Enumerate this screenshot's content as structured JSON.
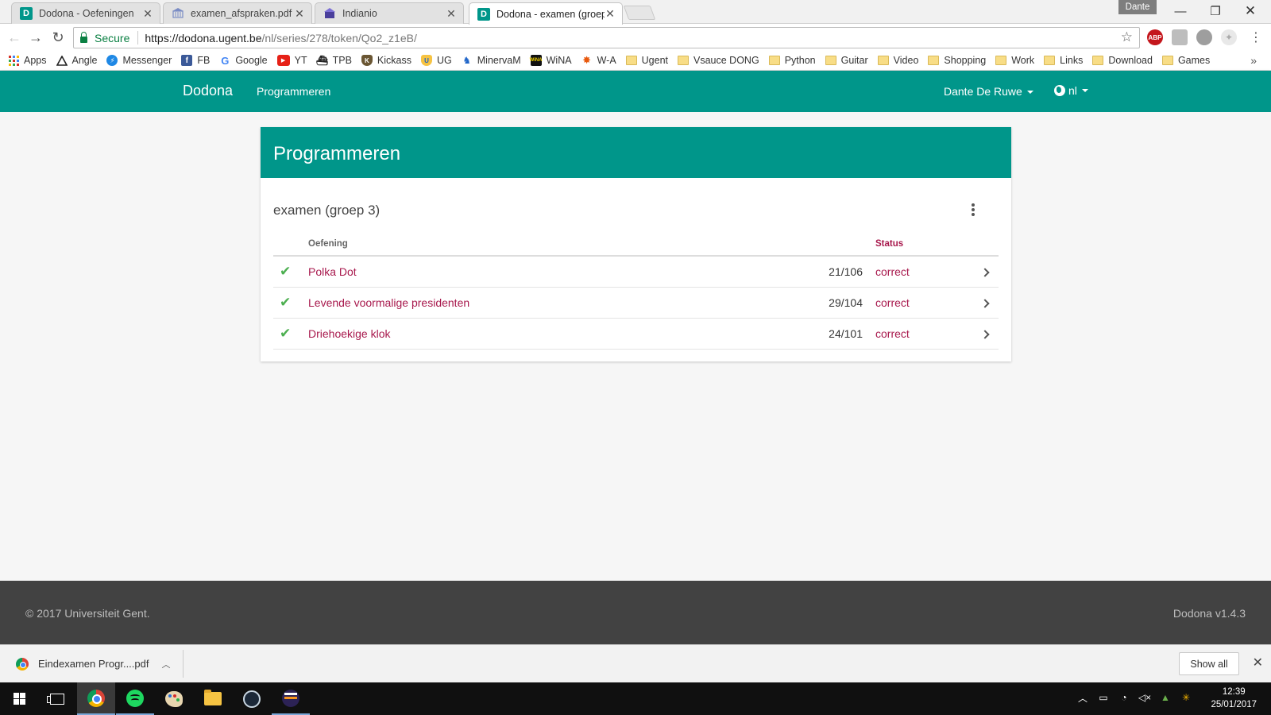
{
  "browser": {
    "tabs": [
      {
        "title": "Dodona - Oefeningen",
        "favicon": "D",
        "icon": "dodona-favicon-icon",
        "active": false
      },
      {
        "title": "examen_afspraken.pdf",
        "icon": "ugent-favicon-icon",
        "active": false
      },
      {
        "title": "Indianio",
        "icon": "indianio-favicon-icon",
        "active": false
      },
      {
        "title": "Dodona - examen (groep",
        "favicon": "D",
        "icon": "dodona-favicon-icon",
        "active": true
      }
    ],
    "profile_name": "Dante",
    "security_label": "Secure",
    "url_host": "https://dodona.ugent.be",
    "url_path": "/nl/series/278/token/Qo2_z1eB/",
    "extensions": [
      {
        "name": "abp-icon",
        "label": "ABP",
        "color": "#c4161c"
      },
      {
        "name": "drive-icon",
        "label": "",
        "color": "#bdbdbd"
      },
      {
        "name": "extension-circle-icon",
        "label": "",
        "color": "#9e9e9e"
      },
      {
        "name": "extension-leaf-icon",
        "label": "",
        "color": "#cfcfcf"
      }
    ]
  },
  "bookmarks": [
    {
      "label": "Apps",
      "icon": "apps-grid-icon"
    },
    {
      "label": "Angle",
      "icon": "triangle-icon"
    },
    {
      "label": "Messenger",
      "icon": "messenger-icon"
    },
    {
      "label": "FB",
      "icon": "facebook-icon"
    },
    {
      "label": "Google",
      "icon": "google-icon"
    },
    {
      "label": "YT",
      "icon": "youtube-icon"
    },
    {
      "label": "TPB",
      "icon": "ship-icon"
    },
    {
      "label": "Kickass",
      "icon": "kickass-icon"
    },
    {
      "label": "UG",
      "icon": "ug-icon"
    },
    {
      "label": "MinervaM",
      "icon": "minerva-icon"
    },
    {
      "label": "WiNA",
      "icon": "wina-icon"
    },
    {
      "label": "W-A",
      "icon": "wolfram-icon"
    },
    {
      "label": "Ugent",
      "icon": "folder-icon"
    },
    {
      "label": "Vsauce DONG",
      "icon": "folder-icon"
    },
    {
      "label": "Python",
      "icon": "folder-icon"
    },
    {
      "label": "Guitar",
      "icon": "folder-icon"
    },
    {
      "label": "Video",
      "icon": "folder-icon"
    },
    {
      "label": "Shopping",
      "icon": "folder-icon"
    },
    {
      "label": "Work",
      "icon": "folder-icon"
    },
    {
      "label": "Links",
      "icon": "folder-icon"
    },
    {
      "label": "Download",
      "icon": "folder-icon"
    },
    {
      "label": "Games",
      "icon": "folder-icon"
    }
  ],
  "app": {
    "brand": "Dodona",
    "nav_link": "Programmeren",
    "user_name": "Dante De Ruwe",
    "language": "nl",
    "accent_color": "#00968a",
    "link_color": "#a8194d"
  },
  "course": {
    "header": "Programmeren",
    "series_title": "examen (groep 3)",
    "columns": {
      "exercise": "Oefening",
      "status": "Status"
    },
    "exercises": [
      {
        "name": "Polka Dot",
        "count": "21/106",
        "status": "correct"
      },
      {
        "name": "Levende voormalige presidenten",
        "count": "29/104",
        "status": "correct"
      },
      {
        "name": "Driehoekige klok",
        "count": "24/101",
        "status": "correct"
      }
    ]
  },
  "footer": {
    "copyright": "© 2017 Universiteit Gent.",
    "version": "Dodona v1.4.3"
  },
  "downloads": {
    "file": "Eindexamen Progr....pdf",
    "show_all": "Show all"
  },
  "taskbar": {
    "apps": [
      {
        "name": "chrome-icon",
        "state": "active"
      },
      {
        "name": "spotify-icon",
        "state": "running"
      },
      {
        "name": "paint-icon",
        "state": ""
      },
      {
        "name": "file-explorer-icon",
        "state": ""
      },
      {
        "name": "steam-icon",
        "state": ""
      },
      {
        "name": "eclipse-icon",
        "state": "running"
      }
    ],
    "time": "12:39",
    "date": "25/01/2017"
  }
}
